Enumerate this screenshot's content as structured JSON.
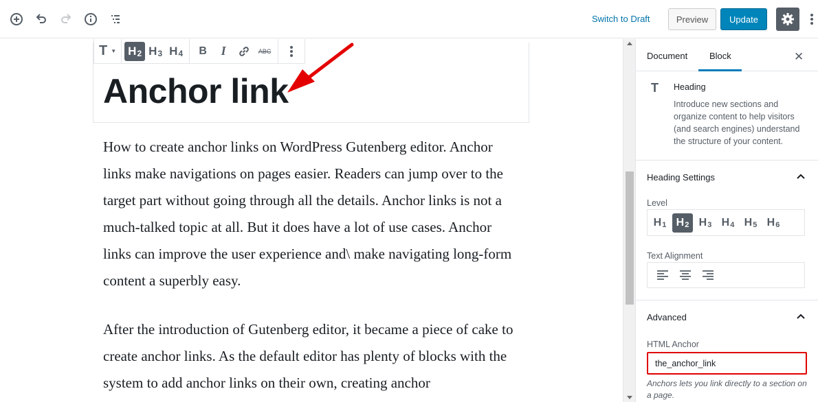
{
  "topbar": {
    "switch_draft_label": "Switch to Draft",
    "preview_label": "Preview",
    "update_label": "Update",
    "icons": [
      "add-block-icon",
      "undo-icon",
      "redo-icon",
      "info-icon",
      "outline-icon",
      "gear-icon",
      "more-vertical-icon"
    ],
    "accent_color": "#0085ba"
  },
  "block_toolbar": {
    "transform_label": "T",
    "h2": {
      "letter": "H",
      "num": "2"
    },
    "h3": {
      "letter": "H",
      "num": "3"
    },
    "h4": {
      "letter": "H",
      "num": "4"
    },
    "bold": "B",
    "italic": "I",
    "strike": "ABC"
  },
  "editor": {
    "heading": "Anchor link",
    "paragraph_1": "How to create anchor links on WordPress Gutenberg editor. Anchor links make navigations on pages easier. Readers can jump over to the target part without going through all the details. Anchor links is not a much-talked topic at all. But it does have a lot of use cases. Anchor links can improve the user experience and\\ make navigating long-form content a superbly easy.",
    "paragraph_2": "After the introduction of Gutenberg editor, it became a piece of cake to create anchor links. As the default editor has plenty of blocks with the system to add anchor links on their own, creating anchor"
  },
  "sidebar": {
    "tabs": [
      {
        "label": "Document"
      },
      {
        "label": "Block"
      }
    ],
    "active_tab": "Block",
    "close_label": "✕",
    "block_card": {
      "icon": "T",
      "title": "Heading",
      "description": "Introduce new sections and organize content to help visitors (and search engines) understand the structure of your content."
    },
    "heading_settings": {
      "title": "Heading Settings",
      "level_label": "Level",
      "levels": [
        {
          "letter": "H",
          "num": "1"
        },
        {
          "letter": "H",
          "num": "2"
        },
        {
          "letter": "H",
          "num": "3"
        },
        {
          "letter": "H",
          "num": "4"
        },
        {
          "letter": "H",
          "num": "5"
        },
        {
          "letter": "H",
          "num": "6"
        }
      ],
      "active_level": "2",
      "text_alignment_label": "Text Alignment"
    },
    "advanced": {
      "title": "Advanced",
      "html_anchor_label": "HTML Anchor",
      "html_anchor_value": "the_anchor_link",
      "help_text": "Anchors lets you link directly to a section on a page."
    }
  }
}
